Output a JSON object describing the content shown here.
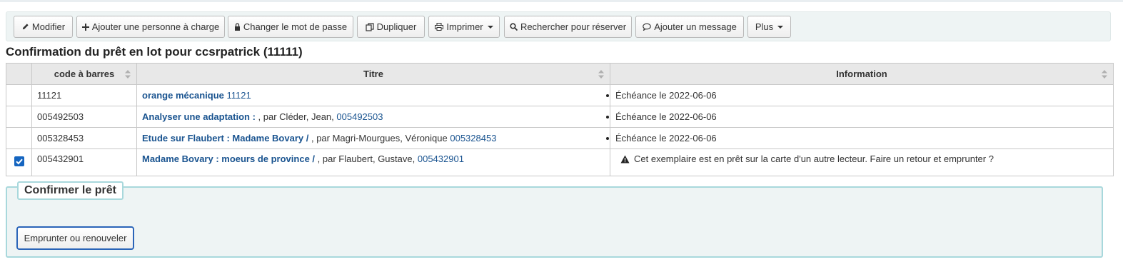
{
  "toolbar": {
    "modifier": "Modifier",
    "ajouter_personne": "Ajouter une personne à charge",
    "changer_mdp": "Changer le mot de passe",
    "dupliquer": "Dupliquer",
    "imprimer": "Imprimer",
    "rechercher": "Rechercher pour réserver",
    "ajouter_message": "Ajouter un message",
    "plus": "Plus"
  },
  "page_title": "Confirmation du prêt en lot pour ccsrpatrick (11111)",
  "table": {
    "headers": [
      "code à barres",
      "Titre",
      "Information"
    ],
    "rows": [
      {
        "checked": false,
        "barcode": "11121",
        "title": "orange mécanique",
        "author": "",
        "title_barcode": "11121",
        "info": "Échéance le 2022-06-06",
        "warning": false
      },
      {
        "checked": false,
        "barcode": "005492503",
        "title": "Analyser une adaptation :",
        "author": ", par Cléder, Jean,",
        "title_barcode": "005492503",
        "info": "Échéance le 2022-06-06",
        "warning": false
      },
      {
        "checked": false,
        "barcode": "005328453",
        "title": "Etude sur Flaubert : Madame Bovary /",
        "author": ", par Magri-Mourgues, Véronique",
        "title_barcode": "005328453",
        "info": "Échéance le 2022-06-06",
        "warning": false
      },
      {
        "checked": true,
        "barcode": "005432901",
        "title": "Madame Bovary : moeurs de province /",
        "author": ", par Flaubert, Gustave,",
        "title_barcode": "005432901",
        "info": "Cet exemplaire est en prêt sur la carte d'un autre lecteur. Faire un retour et emprunter ?",
        "warning": true
      }
    ]
  },
  "confirm": {
    "legend": "Confirmer le prêt",
    "button": "Emprunter ou renouveler"
  },
  "colors": {
    "link": "#1a5490",
    "accent": "#1565c0",
    "panel_border": "#a8d8dc"
  },
  "icons": [
    "pencil-icon",
    "plus-icon",
    "lock-icon",
    "copy-icon",
    "print-icon",
    "search-icon",
    "comment-icon",
    "sort-icon",
    "warning-icon",
    "check-icon"
  ]
}
